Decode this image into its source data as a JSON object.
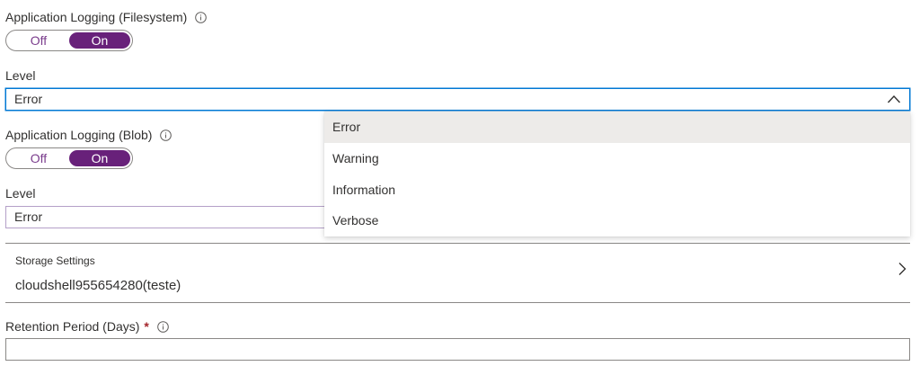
{
  "app_logging_fs": {
    "label": "Application Logging (Filesystem)",
    "toggle": {
      "off_label": "Off",
      "on_label": "On",
      "selected": "On"
    },
    "level_label": "Level",
    "level_value": "Error"
  },
  "dropdown": {
    "options": [
      "Error",
      "Warning",
      "Information",
      "Verbose"
    ],
    "selected": "Error"
  },
  "app_logging_blob": {
    "label": "Application Logging (Blob)",
    "toggle": {
      "off_label": "Off",
      "on_label": "On",
      "selected": "On"
    },
    "level_label": "Level",
    "level_value": "Error"
  },
  "storage": {
    "label": "Storage Settings",
    "value": "cloudshell955654280(teste)"
  },
  "retention": {
    "label": "Retention Period (Days)",
    "required_marker": "*",
    "value": ""
  },
  "colors": {
    "accent": "#68217a",
    "focus_border": "#0078d4",
    "required": "#a4262c",
    "hover_bg": "#edebe9"
  },
  "icons": [
    "info-icon",
    "chevron-up-icon",
    "chevron-right-icon"
  ]
}
